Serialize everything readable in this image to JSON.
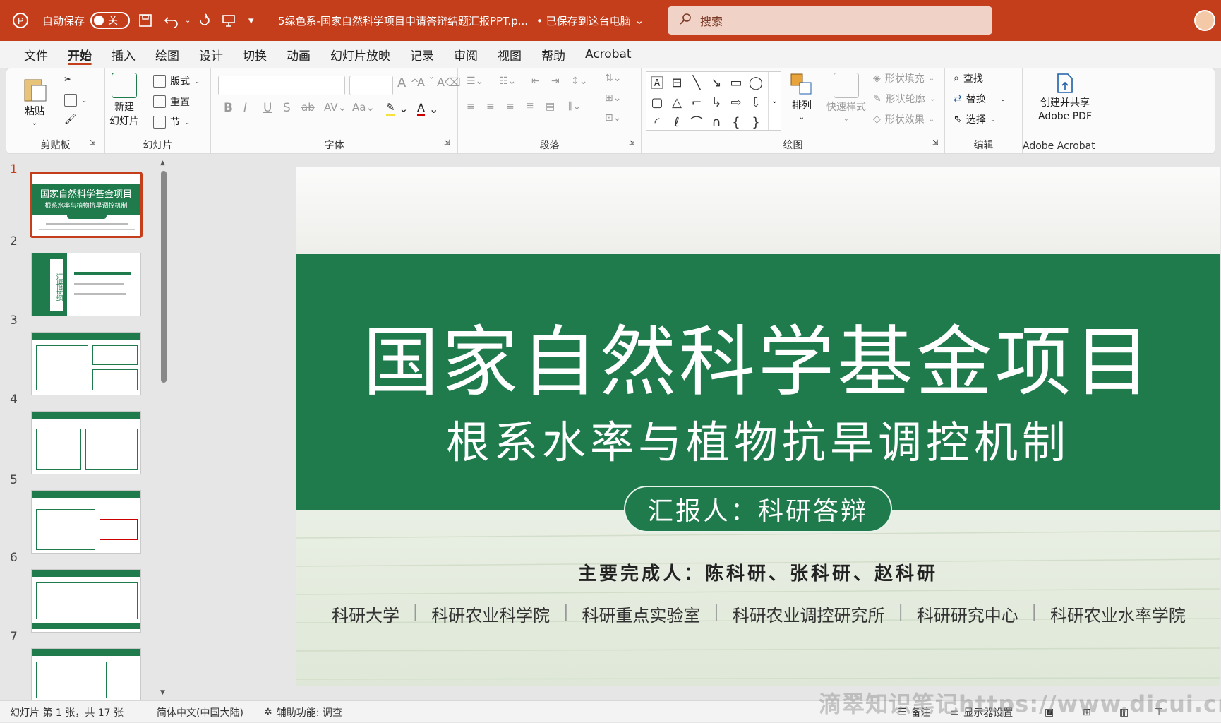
{
  "titlebar": {
    "autosave_label": "自动保存",
    "autosave_state": "关",
    "doc_title": "5绿色系-国家自然科学项目申请答辩结题汇报PPT.p...",
    "save_status": "• 已保存到这台电脑",
    "search_placeholder": "搜索",
    "accent_color": "#c43e1c"
  },
  "menu": {
    "tabs": [
      "文件",
      "开始",
      "插入",
      "绘图",
      "设计",
      "切换",
      "动画",
      "幻灯片放映",
      "记录",
      "审阅",
      "视图",
      "帮助",
      "Acrobat"
    ],
    "active": "开始"
  },
  "ribbon": {
    "clipboard": {
      "paste": "粘贴",
      "label": "剪贴板"
    },
    "slides": {
      "new_slide": "新建\n幻灯片",
      "layout": "版式",
      "reset": "重置",
      "section": "节",
      "label": "幻灯片"
    },
    "font": {
      "label": "字体"
    },
    "paragraph": {
      "label": "段落"
    },
    "drawing": {
      "arrange": "排列",
      "quick_styles": "快速样式",
      "shape_fill": "形状填充",
      "shape_outline": "形状轮廓",
      "shape_effects": "形状效果",
      "label": "绘图"
    },
    "editing": {
      "find": "查找",
      "replace": "替换",
      "select": "选择",
      "label": "编辑"
    },
    "acrobat": {
      "create_share": "创建并共享",
      "adobe_pdf": "Adobe PDF",
      "label": "Adobe Acrobat"
    }
  },
  "thumbnails": {
    "numbers": [
      "1",
      "2",
      "3",
      "4",
      "5",
      "6",
      "7"
    ],
    "selected": "1",
    "slide1_title": "国家自然科学基金项目",
    "slide1_sub": "根系水率与植物抗旱调控机制",
    "slide2_side": "汇报提纲"
  },
  "slide": {
    "title": "国家自然科学基金项目",
    "subtitle": "根系水率与植物抗旱调控机制",
    "reporter": "汇报人：科研答辩",
    "authors": "主要完成人：陈科研、张科研、赵科研",
    "affiliations": [
      "科研大学",
      "科研农业科学院",
      "科研重点实验室",
      "科研农业调控研究所",
      "科研研究中心",
      "科研农业水率学院"
    ],
    "band_color": "#1f7a4c"
  },
  "status": {
    "slide_info": "幻灯片 第 1 张，共 17 张",
    "language": "简体中文(中国大陆)",
    "accessibility": "辅助功能: 调查",
    "notes": "备注",
    "display_settings": "显示器设置"
  },
  "watermark": "滴翠知识笔记https://www.dicui.cn"
}
